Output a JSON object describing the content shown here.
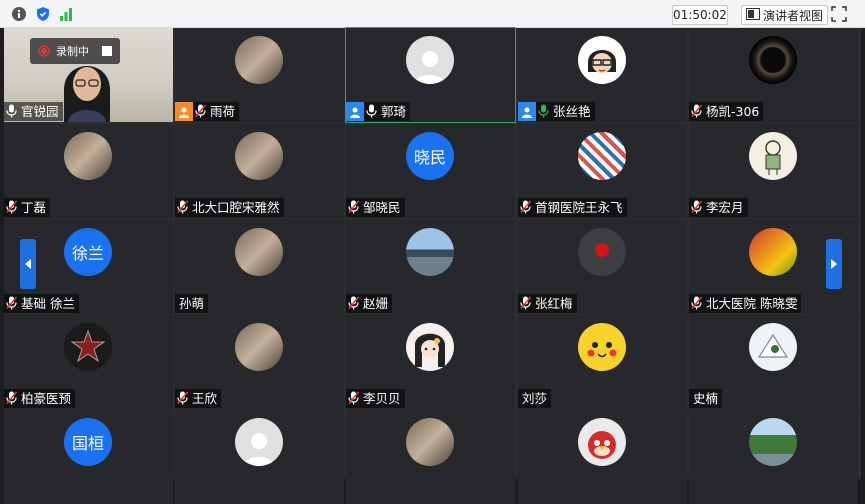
{
  "toolbar": {
    "timer": "01:50:02",
    "speaker_view_label": "演讲者视图",
    "icons": [
      "info-icon",
      "shield-icon",
      "signal-icon",
      "speaker-view-icon",
      "fullscreen-icon"
    ]
  },
  "recording": {
    "label": "录制中"
  },
  "colors": {
    "accent": "#1a72f0",
    "badge_orange": "#f58b2b",
    "badge_blue": "#2f86f0"
  },
  "participants": [
    {
      "name": "官锐园",
      "mic": "on",
      "avatar": "video"
    },
    {
      "name": "雨荷",
      "mic": "off",
      "badge": "orange",
      "avatar": "photo"
    },
    {
      "name": "郭琦",
      "mic": "on",
      "badge": "blue",
      "avatar": "default"
    },
    {
      "name": "张丝艳",
      "mic": "active",
      "badge": "blue",
      "avatar": "cartoon"
    },
    {
      "name": "杨凯-306",
      "mic": "off",
      "avatar": "dark-circle"
    },
    {
      "name": "丁磊",
      "mic": "off",
      "avatar": "photo"
    },
    {
      "name": "北大口腔宋雅然",
      "mic": "off",
      "avatar": "photo"
    },
    {
      "name": "邹晓民",
      "mic": "off",
      "avatar": "text",
      "avatar_text": "晓民"
    },
    {
      "name": "首钢医院王永飞",
      "mic": "off",
      "avatar": "pattern"
    },
    {
      "name": "李宏月",
      "mic": "off",
      "avatar": "sketch"
    },
    {
      "name": "基础 徐兰",
      "mic": "off",
      "avatar": "text",
      "avatar_text": "徐兰"
    },
    {
      "name": "孙萌",
      "mic": "none",
      "avatar": "photo"
    },
    {
      "name": "赵姗",
      "mic": "off",
      "avatar": "landscape"
    },
    {
      "name": "张红梅",
      "mic": "off",
      "avatar": "flower"
    },
    {
      "name": "北大医院 陈晓雯",
      "mic": "off",
      "avatar": "autumn"
    },
    {
      "name": "柏豪医预",
      "mic": "off",
      "avatar": "emblem"
    },
    {
      "name": "王欣",
      "mic": "off",
      "avatar": "photo"
    },
    {
      "name": "李贝贝",
      "mic": "off",
      "avatar": "anime"
    },
    {
      "name": "刘莎",
      "mic": "none",
      "avatar": "pikachu"
    },
    {
      "name": "史楠",
      "mic": "none",
      "avatar": "cartoon2"
    },
    {
      "name": "",
      "mic": "none",
      "avatar": "text",
      "avatar_text": "国桓"
    },
    {
      "name": "",
      "mic": "none",
      "avatar": "default"
    },
    {
      "name": "",
      "mic": "none",
      "avatar": "photo"
    },
    {
      "name": "",
      "mic": "none",
      "avatar": "angrybird"
    },
    {
      "name": "",
      "mic": "none",
      "avatar": "landscape2"
    }
  ]
}
